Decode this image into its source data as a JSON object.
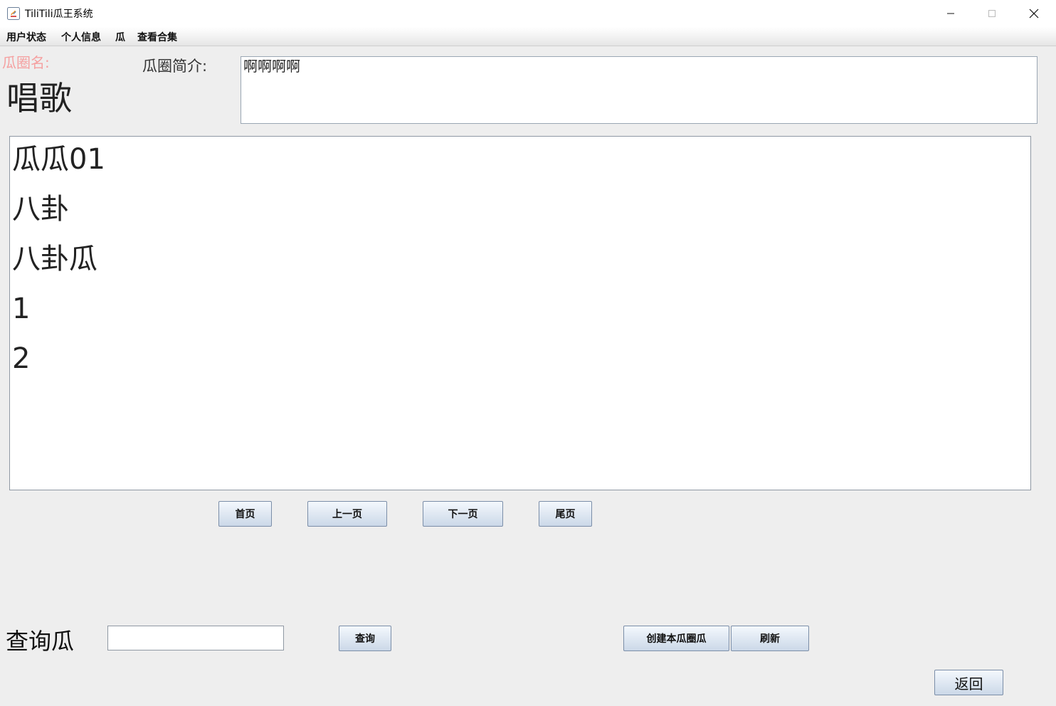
{
  "window": {
    "title": "TiliTili瓜王系统",
    "controls": {
      "minimize": "–",
      "maximize": "☐",
      "close": "✕"
    }
  },
  "menu": [
    "用户状态",
    "个人信息",
    "瓜",
    "查看合集"
  ],
  "circle": {
    "name_label": "瓜圈名:",
    "name": "唱歌",
    "intro_label": "瓜圈简介:",
    "intro": "啊啊啊啊"
  },
  "list": {
    "items": [
      "瓜瓜01",
      "八卦",
      "八卦瓜",
      "1",
      "2"
    ]
  },
  "pagination": {
    "first": "首页",
    "prev": "上一页",
    "next": "下一页",
    "last": "尾页"
  },
  "search": {
    "label": "查询瓜",
    "value": "",
    "button": "查询"
  },
  "actions": {
    "create": "创建本瓜圈瓜",
    "refresh": "刷新",
    "back": "返回"
  },
  "colors": {
    "name_label": "#f5a0a0",
    "button_top": "#f4f8fd",
    "button_bottom": "#cbd8e8"
  }
}
